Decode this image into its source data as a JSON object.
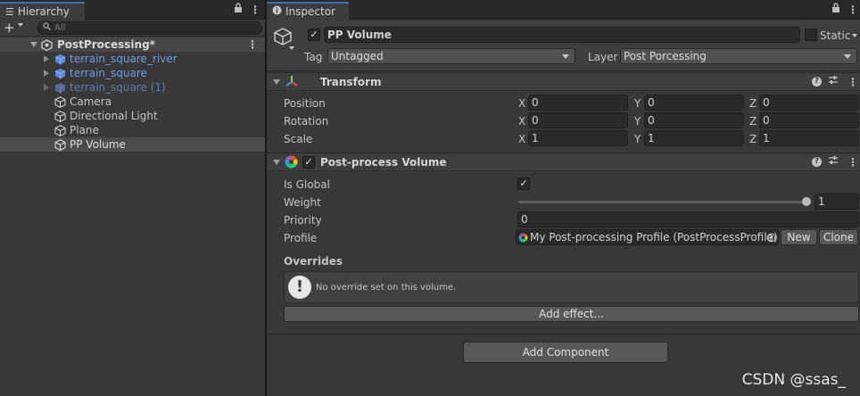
{
  "hierarchy": {
    "tab_label": "Hierarchy",
    "search_placeholder": "All",
    "scene_name": "PostProcessing*",
    "items": [
      {
        "label": "terrain_square_river",
        "kind": "prefab"
      },
      {
        "label": "terrain_square",
        "kind": "prefab"
      },
      {
        "label": "terrain_square (1)",
        "kind": "prefab-inactive"
      },
      {
        "label": "Camera",
        "kind": "object"
      },
      {
        "label": "Directional Light",
        "kind": "object"
      },
      {
        "label": "Plane",
        "kind": "object"
      },
      {
        "label": "PP Volume",
        "kind": "object",
        "selected": true
      }
    ]
  },
  "inspector": {
    "tab_label": "Inspector",
    "object_name": "PP Volume",
    "active": true,
    "static_label": "Static",
    "static_checked": false,
    "tag_label": "Tag",
    "tag_value": "Untagged",
    "layer_label": "Layer",
    "layer_value": "Post Porcessing",
    "transform": {
      "title": "Transform",
      "position_label": "Position",
      "rotation_label": "Rotation",
      "scale_label": "Scale",
      "axis_x": "X",
      "axis_y": "Y",
      "axis_z": "Z",
      "position": {
        "x": "0",
        "y": "0",
        "z": "0"
      },
      "rotation": {
        "x": "0",
        "y": "0",
        "z": "0"
      },
      "scale": {
        "x": "1",
        "y": "1",
        "z": "1"
      }
    },
    "post_process_volume": {
      "title": "Post-process Volume",
      "enabled": true,
      "is_global_label": "Is Global",
      "is_global": true,
      "weight_label": "Weight",
      "weight_value": "1",
      "weight_fraction": 1.0,
      "priority_label": "Priority",
      "priority_value": "0",
      "profile_label": "Profile",
      "profile_value": "My Post-processing Profile (PostProcessProfile)",
      "new_label": "New",
      "clone_label": "Clone",
      "overrides_label": "Overrides",
      "no_override_message": "No override set on this volume.",
      "add_effect_label": "Add effect..."
    },
    "add_component_label": "Add Component"
  },
  "watermark": "CSDN @ssas_",
  "colors": {
    "background": "#383838",
    "prefab_text": "#6f9ae6",
    "tab_accent": "#3a72b0"
  }
}
